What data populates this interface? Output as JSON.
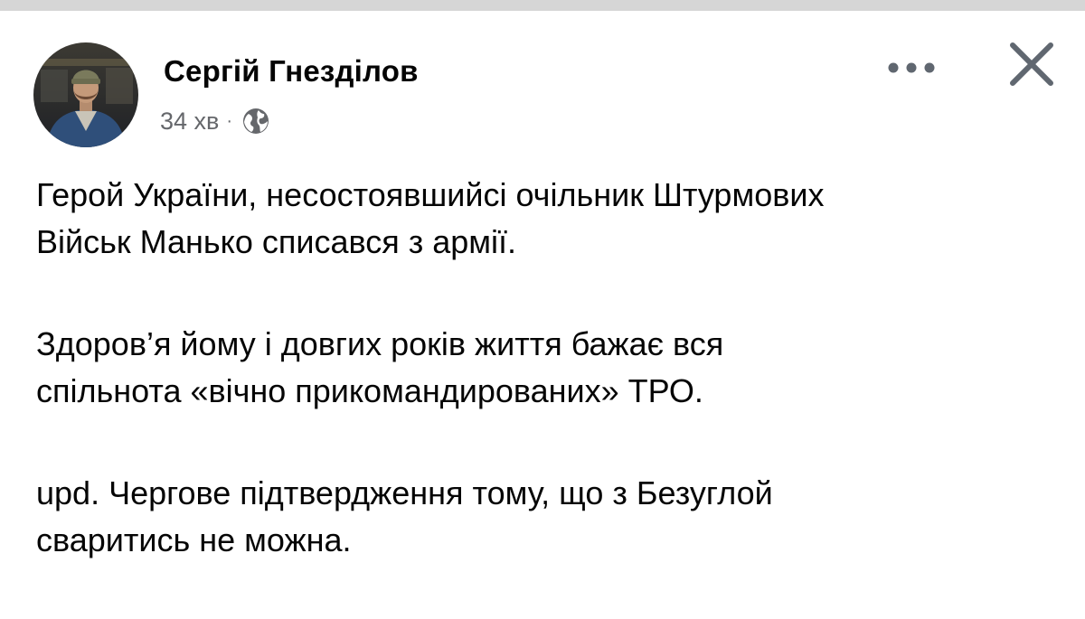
{
  "post": {
    "author": "Сергій Гнезділов",
    "time": "34 хв",
    "separator": "·",
    "privacy_icon": "globe-icon",
    "paragraphs": [
      "Герой України, несостоявшийсі очільник Штурмових\nВійськ Манько списався з армії.",
      "Здоров’я йому і довгих років життя бажає вся\nспільнота «вічно прикомандированих» ТРО.",
      "upd. Чергове підтвердження тому, що з Безуглой\nсваритись не можна."
    ]
  },
  "icons": {
    "more": "more-options-icon",
    "close": "close-icon"
  },
  "colors": {
    "text": "#050505",
    "secondary": "#65676b",
    "top_strip": "#d6d6d6",
    "icon": "#606770"
  }
}
